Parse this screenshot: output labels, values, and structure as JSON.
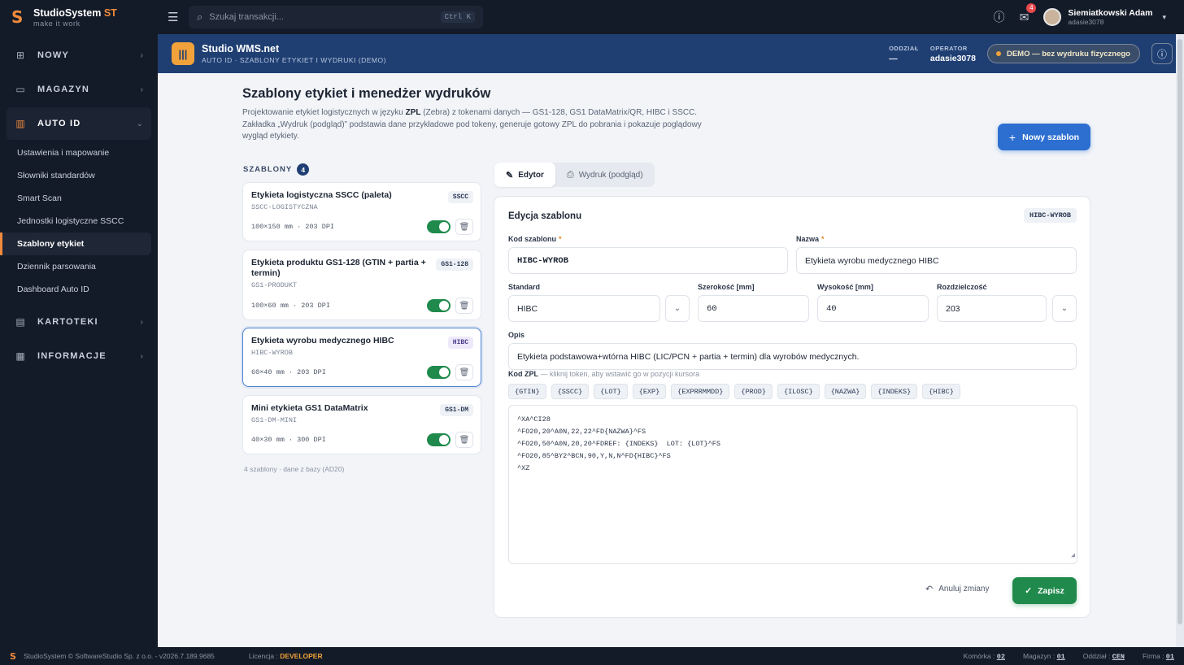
{
  "brand": {
    "name": "StudioSystem",
    "name_suffix": "ST",
    "tagline": "make it work"
  },
  "search": {
    "placeholder": "Szukaj transakcji...",
    "shortcut": "Ctrl K"
  },
  "topbar": {
    "notifications_count": "4",
    "user_name": "Siemiatkowski Adam",
    "user_login": "adasie3078"
  },
  "sidebar": {
    "groups": [
      {
        "label": "NOWY",
        "icon": "plus-square-icon"
      },
      {
        "label": "MAGAZYN",
        "icon": "warehouse-icon"
      },
      {
        "label": "AUTO ID",
        "icon": "barcode-icon"
      }
    ],
    "auto_id_items": [
      {
        "label": "Ustawienia i mapowanie"
      },
      {
        "label": "Słowniki standardów"
      },
      {
        "label": "Smart Scan"
      },
      {
        "label": "Jednostki logistyczne SSCC"
      },
      {
        "label": "Szablony etykiet",
        "active": true
      },
      {
        "label": "Dziennik parsowania"
      },
      {
        "label": "Dashboard Auto ID"
      }
    ],
    "groups_after": [
      {
        "label": "KARTOTEKI",
        "icon": "file-cabinet-icon"
      },
      {
        "label": "INFORMACJE",
        "icon": "document-icon"
      }
    ]
  },
  "header": {
    "title": "Studio WMS.net",
    "subtitle": "AUTO ID · SZABLONY ETYKIET I WYDRUKI (DEMO)",
    "branch_label": "ODDZIAŁ",
    "branch_value": "—",
    "operator_label": "OPERATOR",
    "operator_value": "adasie3078",
    "demo_label": "DEMO — bez wydruku fizycznego"
  },
  "page": {
    "title": "Szablony etykiet i menedżer wydruków",
    "desc_part1": "Projektowanie etykiet logistycznych w języku ",
    "desc_bold": "ZPL",
    "desc_part2": " (Zebra) z tokenami danych — GS1-128, GS1 DataMatrix/QR, HIBC i SSCC. Zakładka „Wydruk (podgląd)” podstawia dane przykładowe pod tokeny, generuje gotowy ZPL do pobrania i pokazuje poglądowy wygląd etykiety.",
    "new_button": "Nowy szablon"
  },
  "templates": {
    "heading": "SZABLONY",
    "count": "4",
    "items": [
      {
        "name": "Etykieta logistyczna SSCC (paleta)",
        "code": "SSCC-LOGISTYCZNA",
        "badge": "SSCC",
        "meta": "100×150 mm · 203 DPI"
      },
      {
        "name": "Etykieta produktu GS1-128 (GTIN + partia + termin)",
        "code": "GS1-PRODUKT",
        "badge": "GS1-128",
        "meta": "100×60 mm · 203 DPI"
      },
      {
        "name": "Etykieta wyrobu medycznego HIBC",
        "code": "HIBC-WYROB",
        "badge": "HIBC",
        "meta": "60×40 mm · 203 DPI"
      },
      {
        "name": "Mini etykieta GS1 DataMatrix",
        "code": "GS1-DM-MINI",
        "badge": "GS1-DM",
        "meta": "40×30 mm · 300 DPI"
      }
    ],
    "footer": "4 szablony · dane z bazy (AD20)"
  },
  "tabs": {
    "editor": "Edytor",
    "preview": "Wydruk (podgląd)"
  },
  "editor": {
    "title": "Edycja szablonu",
    "badge": "HIBC-WYROB",
    "code_label": "Kod szablonu",
    "code_value": "HIBC-WYROB",
    "name_label": "Nazwa",
    "name_value": "Etykieta wyrobu medycznego HIBC",
    "standard_label": "Standard",
    "standard_value": "HIBC",
    "width_label": "Szerokość [mm]",
    "width_value": "60",
    "height_label": "Wysokość [mm]",
    "height_value": "40",
    "dpi_label": "Rozdzielczość",
    "dpi_value": "203",
    "desc_label": "Opis",
    "desc_value": "Etykieta podstawowa+wtórna HIBC (LIC/PCN + partia + termin) dla wyrobów medycznych.",
    "zpl_label": "Kod ZPL",
    "zpl_hint": " — kliknij token, aby wstawić go w pozycji kursora",
    "tokens": [
      "{GTIN}",
      "{SSCC}",
      "{LOT}",
      "{EXP}",
      "{EXPRRMMDD}",
      "{PROD}",
      "{ILOSC}",
      "{NAZWA}",
      "{INDEKS}",
      "{HIBC}"
    ],
    "zpl_code": "^XA^CI28\n^FO20,20^A0N,22,22^FD{NAZWA}^FS\n^FO20,50^A0N,20,20^FDREF: {INDEKS}  LOT: {LOT}^FS\n^FO20,85^BY2^BCN,90,Y,N,N^FD{HIBC}^FS\n^XZ",
    "cancel_label": "Anuluj zmiany",
    "save_label": "Zapisz"
  },
  "footer": {
    "copyright": "StudioSystem © SoftwareStudio Sp. z o.o. - v2026.7.189.9685",
    "license_label": "Licencja : ",
    "license_value": "DEVELOPER",
    "cell_label": "Komórka : ",
    "cell_value": "02",
    "warehouse_label": "Magazyn : ",
    "warehouse_value": "01",
    "branch_label": "Oddział : ",
    "branch_value": "CEN",
    "company_label": "Firma : ",
    "company_value": "01"
  }
}
